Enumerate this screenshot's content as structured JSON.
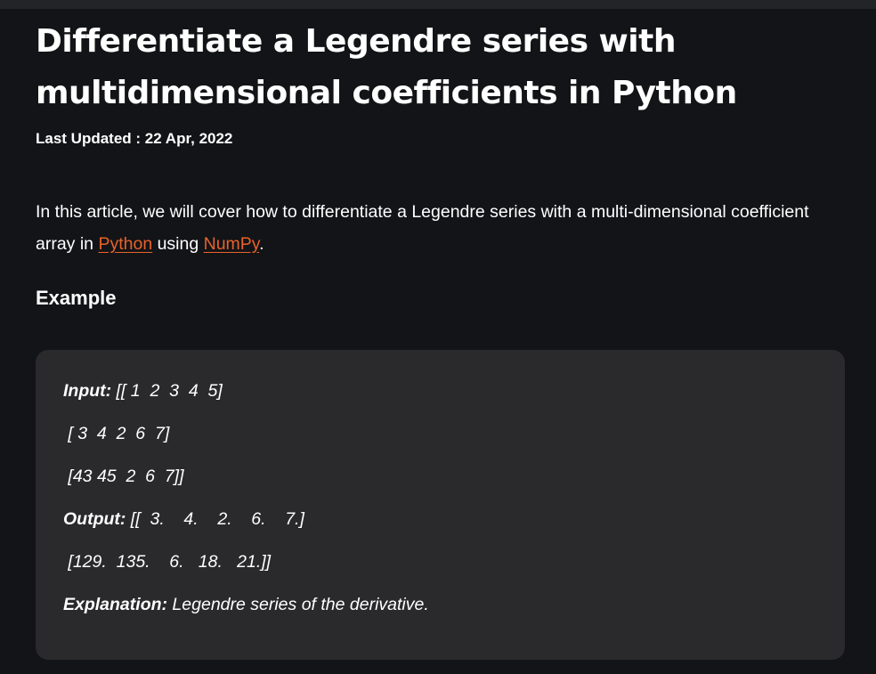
{
  "article": {
    "title": "Differentiate a Legendre series with multidimensional coefficients in Python",
    "last_updated": "Last Updated : 22 Apr, 2022",
    "intro": {
      "before_python": "In this article, we will cover how to differentiate a Legendre series with a multi-dimensional coefficient array in ",
      "python_link": "Python",
      "between_links": " using ",
      "numpy_link": "NumPy",
      "after_numpy": "."
    },
    "example_heading": "Example"
  },
  "example": {
    "input_label": "Input:",
    "input_line1": " [[ 1  2  3  4  5]",
    "input_line2": " [ 3  4  2  6  7]",
    "input_line3": " [43 45  2  6  7]]",
    "output_label": "Output:",
    "output_line1": " [[  3.    4.    2.    6.    7.]",
    "output_line2": " [129.  135.    6.   18.   21.]]",
    "explanation_label": "Explanation:",
    "explanation_text": " Legendre series of the derivative."
  },
  "colors": {
    "background": "#131417",
    "top_bar": "#232427",
    "code_box": "#2a2a2c",
    "link": "#e8622b",
    "text": "#ffffff"
  }
}
